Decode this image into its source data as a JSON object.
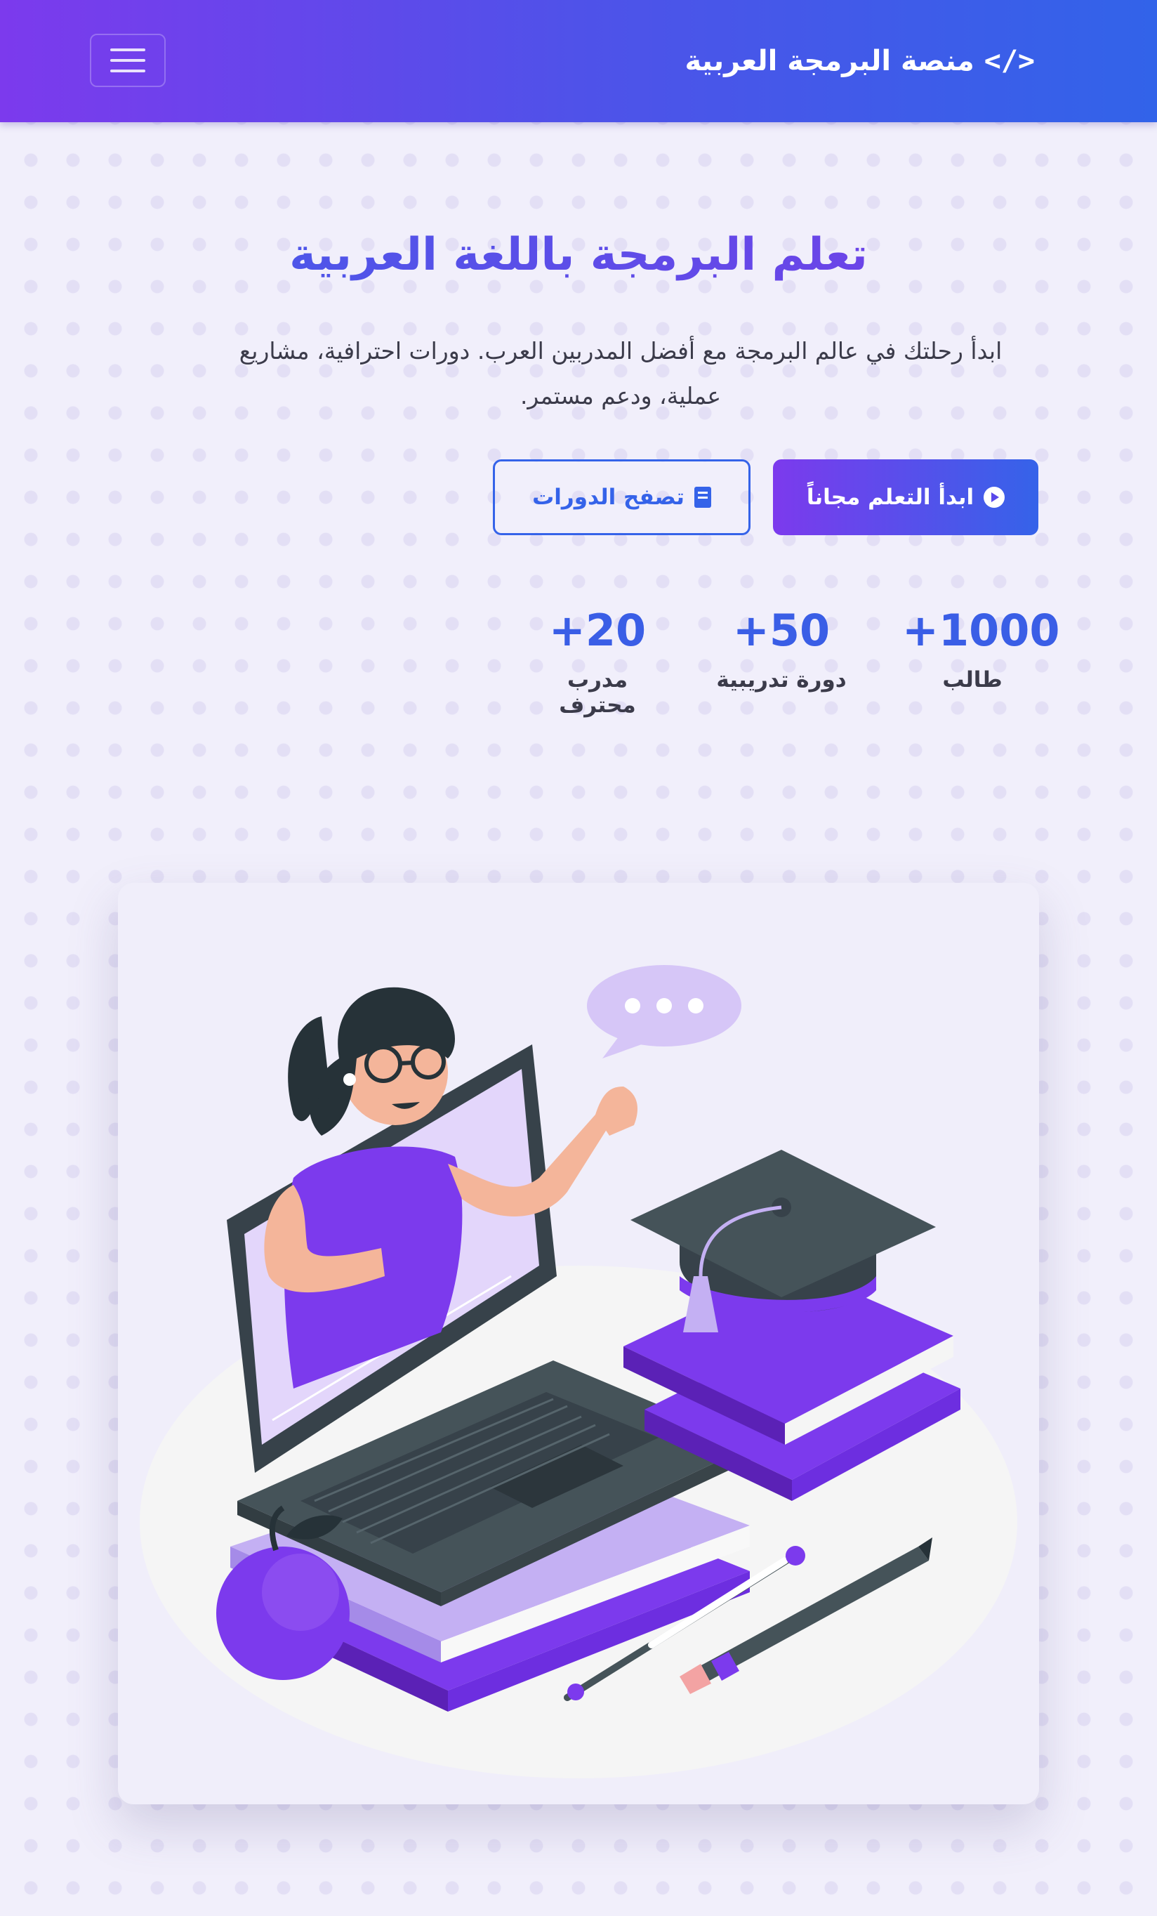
{
  "navbar": {
    "brand_icon": "</>",
    "brand_text": "منصة البرمجة العربية",
    "menu_icon": "hamburger-menu-icon"
  },
  "hero": {
    "title": "تعلم البرمجة باللغة العربية",
    "description": "ابدأ رحلتك في عالم البرمجة مع أفضل المدربين العرب. دورات احترافية، مشاريع عملية، ودعم مستمر.",
    "primary_button": {
      "label": "ابدأ التعلم مجاناً",
      "icon": "play-circle-icon"
    },
    "secondary_button": {
      "label": "تصفح الدورات",
      "icon": "book-icon"
    }
  },
  "stats": [
    {
      "number": "+1000",
      "label": "طالب"
    },
    {
      "number": "+50",
      "label": "دورة تدريبية"
    },
    {
      "number": "+20",
      "label": "مدرب محترف"
    }
  ],
  "illustration": {
    "subject": "online-learning-illustration",
    "colors": {
      "accent": "#7c3aed",
      "dark": "#455359",
      "light": "#c4b0f3"
    }
  },
  "colors": {
    "gradient_start": "#7c3aed",
    "gradient_end": "#3263e9",
    "stat_number": "#3a5ee6",
    "page_bg": "#f1effb"
  }
}
